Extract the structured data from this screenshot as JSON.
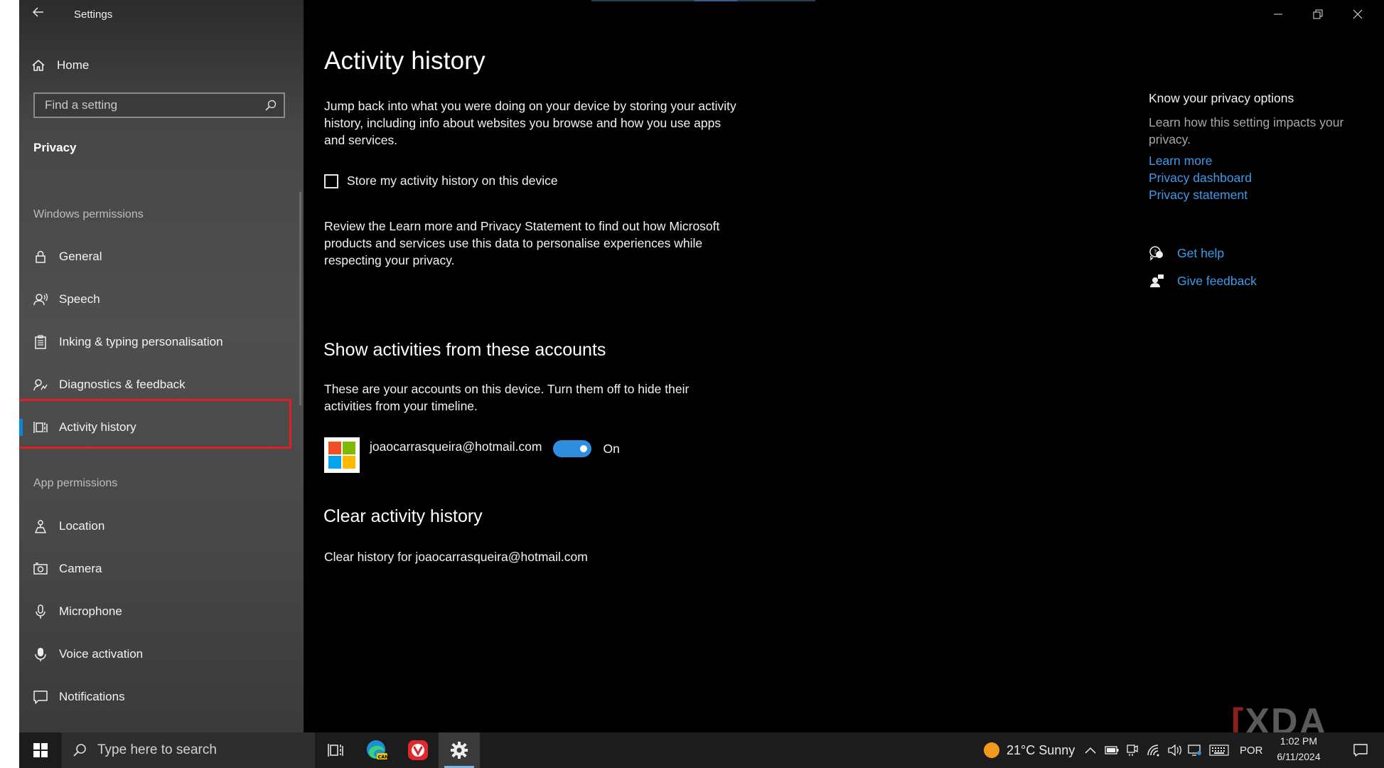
{
  "window": {
    "title": "Settings",
    "controls": [
      "minimize",
      "restore",
      "close"
    ]
  },
  "sidebar": {
    "home_label": "Home",
    "search_placeholder": "Find a setting",
    "section_title": "Privacy",
    "windows_permissions_heading": "Windows permissions",
    "windows_permissions": [
      {
        "label": "General",
        "icon": "lock-icon"
      },
      {
        "label": "Speech",
        "icon": "speech-icon"
      },
      {
        "label": "Inking & typing personalisation",
        "icon": "clipboard-icon"
      },
      {
        "label": "Diagnostics & feedback",
        "icon": "diagnostics-icon"
      },
      {
        "label": "Activity history",
        "icon": "activity-history-icon",
        "selected": true
      }
    ],
    "app_permissions_heading": "App permissions",
    "app_permissions": [
      {
        "label": "Location",
        "icon": "location-icon"
      },
      {
        "label": "Camera",
        "icon": "camera-icon"
      },
      {
        "label": "Microphone",
        "icon": "microphone-icon"
      },
      {
        "label": "Voice activation",
        "icon": "voice-activation-icon"
      },
      {
        "label": "Notifications",
        "icon": "notifications-icon"
      }
    ]
  },
  "main": {
    "title": "Activity history",
    "intro": "Jump back into what you were doing on your device by storing your activity history, including info about websites you browse and how you use apps and services.",
    "store_checkbox_label": "Store my activity history on this device",
    "store_checkbox_checked": false,
    "review_text": "Review the Learn more and Privacy Statement to find out how Microsoft products and services use this data to personalise experiences while respecting your privacy.",
    "accounts_heading": "Show activities from these accounts",
    "accounts_text": "These are your accounts on this device. Turn them off to hide their activities from your timeline.",
    "account_email": "joaocarrasqueira@hotmail.com",
    "account_toggle_state": "On",
    "clear_heading": "Clear activity history",
    "clear_text": "Clear history for joaocarrasqueira@hotmail.com"
  },
  "right": {
    "heading": "Know your privacy options",
    "text": "Learn how this setting impacts your privacy.",
    "links": [
      "Learn more",
      "Privacy dashboard",
      "Privacy statement"
    ],
    "get_help": "Get help",
    "give_feedback": "Give feedback"
  },
  "watermark": {
    "bracket": "[",
    "text": "XDA"
  },
  "taskbar": {
    "search_placeholder": "Type here to search",
    "weather": "21°C  Sunny",
    "language": "POR",
    "time": "1:02 PM",
    "date": "6/11/2024",
    "edge_badge": "CAN"
  },
  "colors": {
    "accent": "#0a84d8",
    "link": "#3d9be9",
    "highlight_box": "#e01e24",
    "toggle_on": "#2f8fde"
  }
}
